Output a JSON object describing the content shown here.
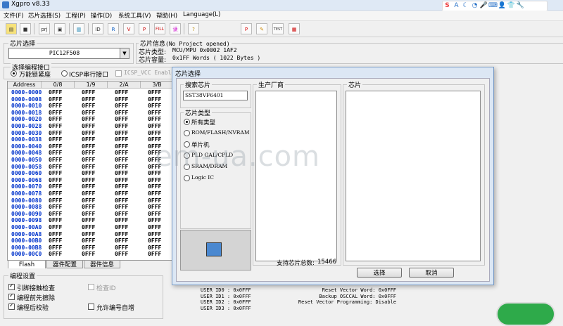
{
  "window": {
    "title": "Xgpro v8.33"
  },
  "ime_icons": [
    "S",
    "A",
    "☾",
    "◔",
    "🎤",
    "⌨",
    "👤",
    "👕",
    "🔧"
  ],
  "menu": [
    "文件(F)",
    "芯片选择(S)",
    "工程(P)",
    "操作(D)",
    "系统工具(V)",
    "帮助(H)",
    "Language(L)"
  ],
  "toolbar": {
    "buttons": [
      "open",
      "save",
      "prj",
      "save-prj",
      "load",
      "ID",
      "read",
      "verify",
      "FILL",
      "read2",
      "info"
    ],
    "right_buttons": [
      "P",
      "edit",
      "TEST",
      "IC"
    ]
  },
  "chip_select": {
    "title": "芯片选择",
    "value": "PIC12F508"
  },
  "chip_info": {
    "title": "芯片信息",
    "project": "(No Project opened)",
    "type_label": "芯片类型:",
    "type_value": "MCU/MPU   0x0002 1AF2",
    "cap_label": "芯片容量:",
    "cap_value": "0x1FF Words ( 1022 Bytes )"
  },
  "interface": {
    "title": "选择编程接口",
    "opt1": "万能锁紧座",
    "opt2": "ICSP串行接口",
    "opt3": "ICSP_VCC Enable"
  },
  "table": {
    "headers": [
      "Address",
      "0/8",
      "1/9",
      "2/A",
      "3/B"
    ],
    "rows": [
      [
        "0000-0000",
        "0FFF",
        "0FFF",
        "0FFF",
        "0FFF"
      ],
      [
        "0000-0008",
        "0FFF",
        "0FFF",
        "0FFF",
        "0FFF"
      ],
      [
        "0000-0010",
        "0FFF",
        "0FFF",
        "0FFF",
        "0FFF"
      ],
      [
        "0000-0018",
        "0FFF",
        "0FFF",
        "0FFF",
        "0FFF"
      ],
      [
        "0000-0020",
        "0FFF",
        "0FFF",
        "0FFF",
        "0FFF"
      ],
      [
        "0000-0028",
        "0FFF",
        "0FFF",
        "0FFF",
        "0FFF"
      ],
      [
        "0000-0030",
        "0FFF",
        "0FFF",
        "0FFF",
        "0FFF"
      ],
      [
        "0000-0038",
        "0FFF",
        "0FFF",
        "0FFF",
        "0FFF"
      ],
      [
        "0000-0040",
        "0FFF",
        "0FFF",
        "0FFF",
        "0FFF"
      ],
      [
        "0000-0048",
        "0FFF",
        "0FFF",
        "0FFF",
        "0FFF"
      ],
      [
        "0000-0050",
        "0FFF",
        "0FFF",
        "0FFF",
        "0FFF"
      ],
      [
        "0000-0058",
        "0FFF",
        "0FFF",
        "0FFF",
        "0FFF"
      ],
      [
        "0000-0060",
        "0FFF",
        "0FFF",
        "0FFF",
        "0FFF"
      ],
      [
        "0000-0068",
        "0FFF",
        "0FFF",
        "0FFF",
        "0FFF"
      ],
      [
        "0000-0070",
        "0FFF",
        "0FFF",
        "0FFF",
        "0FFF"
      ],
      [
        "0000-0078",
        "0FFF",
        "0FFF",
        "0FFF",
        "0FFF"
      ],
      [
        "0000-0080",
        "0FFF",
        "0FFF",
        "0FFF",
        "0FFF"
      ],
      [
        "0000-0088",
        "0FFF",
        "0FFF",
        "0FFF",
        "0FFF"
      ],
      [
        "0000-0090",
        "0FFF",
        "0FFF",
        "0FFF",
        "0FFF"
      ],
      [
        "0000-0098",
        "0FFF",
        "0FFF",
        "0FFF",
        "0FFF"
      ],
      [
        "0000-00A0",
        "0FFF",
        "0FFF",
        "0FFF",
        "0FFF"
      ],
      [
        "0000-00A8",
        "0FFF",
        "0FFF",
        "0FFF",
        "0FFF"
      ],
      [
        "0000-00B0",
        "0FFF",
        "0FFF",
        "0FFF",
        "0FFF"
      ],
      [
        "0000-00B8",
        "0FFF",
        "0FFF",
        "0FFF",
        "0FFF"
      ],
      [
        "0000-00C0",
        "0FFF",
        "0FFF",
        "0FFF",
        "0FFF"
      ]
    ]
  },
  "tabs": [
    "Flash",
    "器件配置",
    "器件信息"
  ],
  "prog_settings": {
    "title": "编程设置",
    "c1": "引脚接触检查",
    "c2": "编程前先擦除",
    "c3": "编程后校验",
    "c4": "检查ID",
    "c5": "允许编号自增"
  },
  "config_words": {
    "left": [
      "USER ID0 : 0x0FFF",
      "USER ID1 : 0x0FFF",
      "USER ID2 : 0x0FFF",
      "USER ID3 : 0x0FFF"
    ],
    "right": [
      "Reset Vector Word: 0x0FFF",
      "Backup OSCCAL Word: 0x0FFF",
      "Reset Vector Programming: Disable"
    ]
  },
  "dialog": {
    "title": "芯片选择",
    "search_label": "搜索芯片",
    "search_value": "SST38VF6401",
    "type_label": "芯片类型",
    "types": [
      "所有类型",
      "ROM/FLASH/NVRAM",
      "单片机",
      "PLD GAL/CPLD",
      "SRAM/DRAM",
      "Logic IC"
    ],
    "maker_label": "生产厂商",
    "chip_label": "芯片",
    "count_label": "支持芯片总数:",
    "count_value": "15466",
    "ok": "选择",
    "cancel": "取消"
  },
  "watermark": "em-ua.com"
}
